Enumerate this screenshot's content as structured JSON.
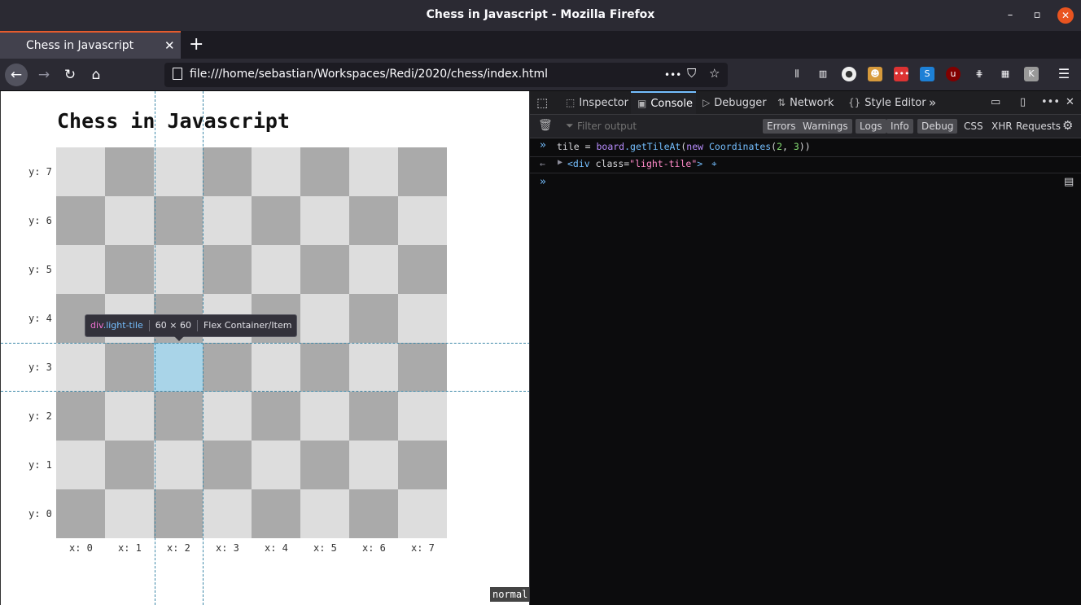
{
  "window": {
    "title": "Chess in Javascript - Mozilla Firefox",
    "controls": {
      "minimize": "–",
      "maximize": "▫",
      "close": "✕"
    }
  },
  "tabs": [
    {
      "label": "Chess in Javascript",
      "close": "✕",
      "active": true
    }
  ],
  "new_tab": "+",
  "nav": {
    "url": "file:///home/sebastian/Workspaces/Redi/2020/chess/index.html",
    "more": "•••",
    "back_icon": "arrow-left-icon",
    "forward_icon": "arrow-right-icon",
    "reload_icon": "reload-icon",
    "home_icon": "home-icon"
  },
  "page": {
    "heading": "Chess in Javascript",
    "y_labels": [
      "y: 7",
      "y: 6",
      "y: 5",
      "y: 4",
      "y: 3",
      "y: 2",
      "y: 1",
      "y: 0"
    ],
    "x_labels": [
      "x: 0",
      "x: 1",
      "x: 2",
      "x: 3",
      "x: 4",
      "x: 5",
      "x: 6",
      "x: 7"
    ],
    "highlighted_tile": {
      "x": 2,
      "y": 3
    },
    "infobar": {
      "tag": "div",
      "class": ".light-tile",
      "size": "60 × 60",
      "kind": "Flex Container/Item"
    },
    "mode": "normal",
    "colors": {
      "light": "#dddddd",
      "dark": "#aaaaaa",
      "highlight": "#a9d4e8"
    }
  },
  "devtools": {
    "tabs": [
      "Inspector",
      "Console",
      "Debugger",
      "Network",
      "Style Editor"
    ],
    "active_tab": "Console",
    "filter_placeholder": "Filter output",
    "filters": [
      "Errors",
      "Warnings",
      "Logs",
      "Info",
      "Debug"
    ],
    "extra_filters": [
      "CSS",
      "XHR",
      "Requests"
    ],
    "input_line": {
      "var": "tile",
      "eq": " = ",
      "obj": "board",
      "method": ".getTileAt",
      "open": "(",
      "kw": "new",
      "ctor": " Coordinates",
      "args_open": "(",
      "a1": "2",
      "comma": ", ",
      "a2": "3",
      "close": "))"
    },
    "output_line": {
      "open": "<div",
      "attr": " class=",
      "val": "\"light-tile\"",
      "close": ">"
    }
  }
}
